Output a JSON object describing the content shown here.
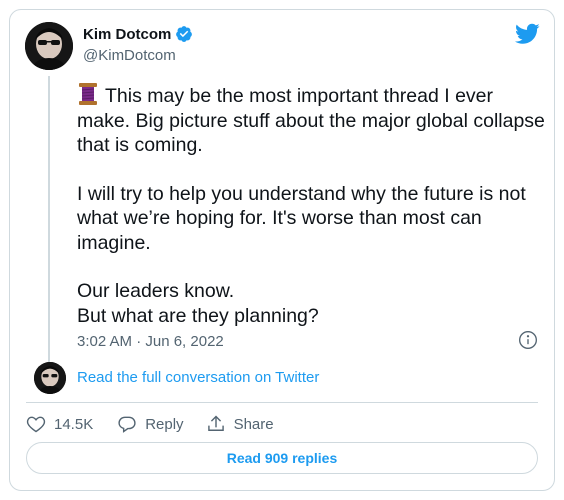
{
  "author": {
    "name": "Kim Dotcom",
    "handle": "@KimDotcom",
    "verified": true
  },
  "tweet": {
    "paragraphs": [
      "This may be the most important thread I ever make. Big picture stuff about the major global collapse that is coming.",
      "I will try to help you understand why the future is not what we’re hoping for. It's worse than most can imagine.",
      "Our leaders know.",
      "But what are they planning?"
    ],
    "emoji": "thread-spool-icon",
    "timestamp": "3:02 AM · Jun 6, 2022"
  },
  "conversation": {
    "link_label": "Read the full conversation on Twitter"
  },
  "actions": {
    "likes": "14.5K",
    "reply_label": "Reply",
    "share_label": "Share"
  },
  "replies_button": {
    "label": "Read 909 replies"
  },
  "colors": {
    "accent": "#1d9bf0",
    "muted": "#536471",
    "border": "#cfd9de",
    "text": "#0f1419"
  },
  "icons": [
    "verified-badge-icon",
    "twitter-bird-icon",
    "info-icon",
    "heart-icon",
    "reply-bubble-icon",
    "share-icon",
    "thread-spool-icon"
  ]
}
